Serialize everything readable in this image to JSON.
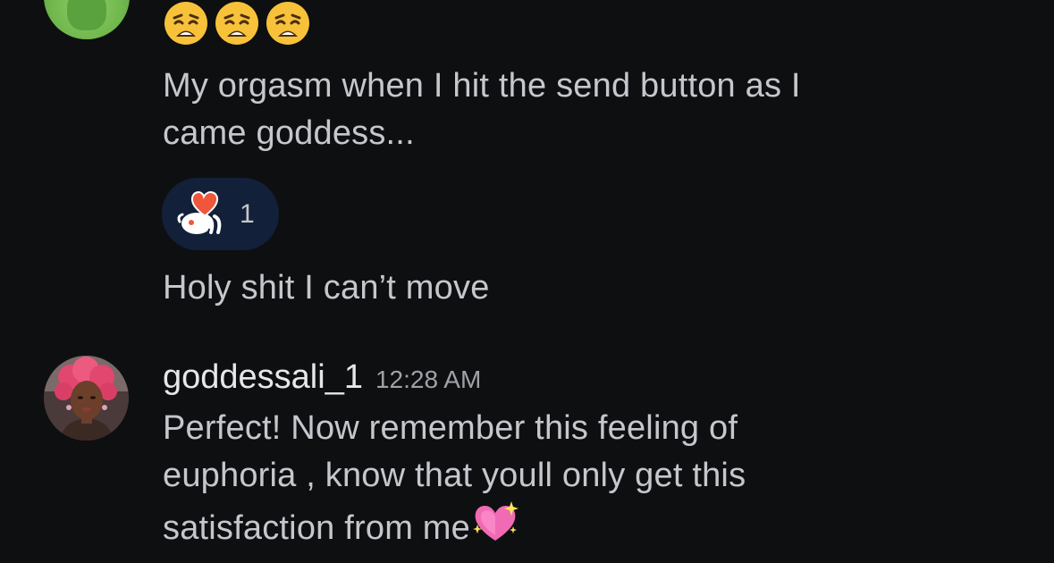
{
  "thread": {
    "previous_message": {
      "emojis": [
        "weary-face",
        "weary-face",
        "weary-face"
      ],
      "text": "My orgasm when I hit the send button as I\ncame goddess...",
      "reaction": {
        "icon": "reddit-snoo-heart-icon",
        "count": "1"
      },
      "followup_text": "Holy shit I can’t move"
    },
    "reply": {
      "username": "goddessali_1",
      "timestamp": "12:28 AM",
      "text": "Perfect! Now remember this feeling of\neuphoria , know that youll only get this\nsatisfaction from me",
      "trailing_emoji": "sparkling-heart"
    }
  },
  "colors": {
    "background": "#0e0f11",
    "text": "#c4c7cc",
    "reaction_pill": "#13203a",
    "accent_heart": "#f0563a"
  }
}
